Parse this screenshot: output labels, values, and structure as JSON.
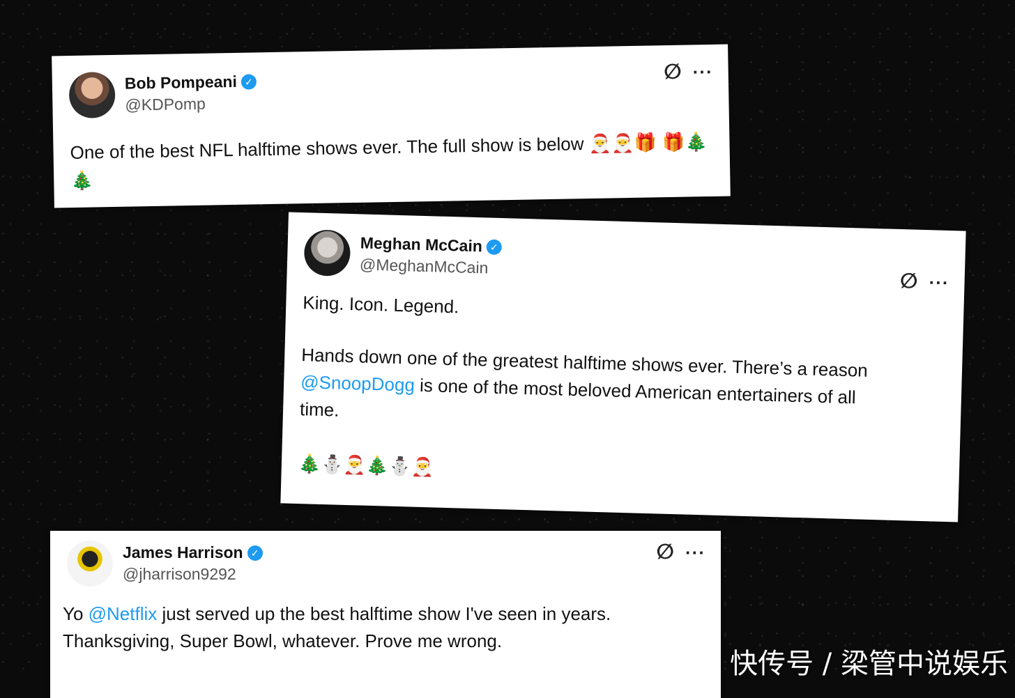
{
  "tweets": [
    {
      "name": "Bob Pompeani",
      "handle": "@KDPomp",
      "text": "One of the best NFL halftime shows ever. The full show is below",
      "emojis": "🎅🎅🎁 🎁🎄🎄"
    },
    {
      "name": "Meghan McCain",
      "handle": "@MeghanMcCain",
      "line1": "King. Icon. Legend.",
      "line2": "Hands down one of the greatest halftime shows ever. There’s a reason",
      "mention": "@SnoopDogg",
      "line3": " is one of the most beloved American entertainers of all",
      "line4": "time.",
      "emojis": "🎄⛄🎅🎄⛄🎅"
    },
    {
      "name": "James Harrison",
      "handle": "@jharrison9292",
      "pre": "Yo ",
      "mention": "@Netflix",
      "post": " just served up the best halftime show I've seen in years.",
      "line2": "Thanksgiving, Super Bowl, whatever. Prove me wrong."
    }
  ],
  "watermark": "快传号 / 梁管中说娱乐",
  "icons": {
    "grok": "grok-icon",
    "more": "more-icon",
    "verified": "verified-badge-icon"
  },
  "colors": {
    "mention": "#1d9bf0",
    "verified": "#1d9bf0"
  }
}
